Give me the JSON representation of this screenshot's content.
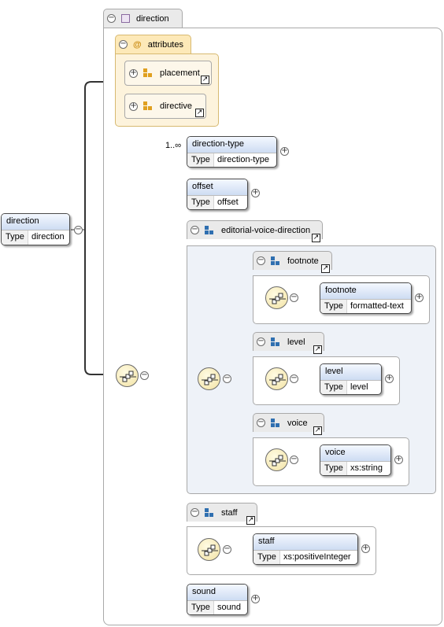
{
  "root_element": {
    "name": "direction",
    "type_label": "Type",
    "type": "direction"
  },
  "complex_type": {
    "name": "direction"
  },
  "attributes_group": {
    "name": "attributes",
    "items": [
      {
        "name": "placement"
      },
      {
        "name": "directive"
      }
    ]
  },
  "sequence": {
    "direction_type": {
      "name": "direction-type",
      "type_label": "Type",
      "type": "direction-type",
      "cardinality": "1..∞"
    },
    "offset": {
      "name": "offset",
      "type_label": "Type",
      "type": "offset"
    },
    "editorial_voice_direction": {
      "name": "editorial-voice-direction",
      "footnote_group": {
        "name": "footnote",
        "element": {
          "name": "footnote",
          "type_label": "Type",
          "type": "formatted-text"
        }
      },
      "level_group": {
        "name": "level",
        "element": {
          "name": "level",
          "type_label": "Type",
          "type": "level"
        }
      },
      "voice_group": {
        "name": "voice",
        "element": {
          "name": "voice",
          "type_label": "Type",
          "type": "xs:string"
        }
      }
    },
    "staff_group": {
      "name": "staff",
      "element": {
        "name": "staff",
        "type_label": "Type",
        "type": "xs:positiveInteger"
      }
    },
    "sound": {
      "name": "sound",
      "type_label": "Type",
      "type": "sound"
    }
  },
  "colors": {
    "element_header_top": "#f4f8ff",
    "element_header_bottom": "#cddcf2",
    "attributes_fill": "#fdf3dc",
    "group_fill": "#eef2f8",
    "group_icon": "#2f6fb0",
    "attribute_icon": "#e0a020",
    "connector": "#333333"
  },
  "icons": {
    "expand": "plus-circle-icon",
    "collapse": "minus-circle-icon",
    "jump": "jump-arrow-icon",
    "sequence": "sequence-compositor-icon",
    "group": "model-group-icon",
    "attribute": "attribute-icon"
  }
}
